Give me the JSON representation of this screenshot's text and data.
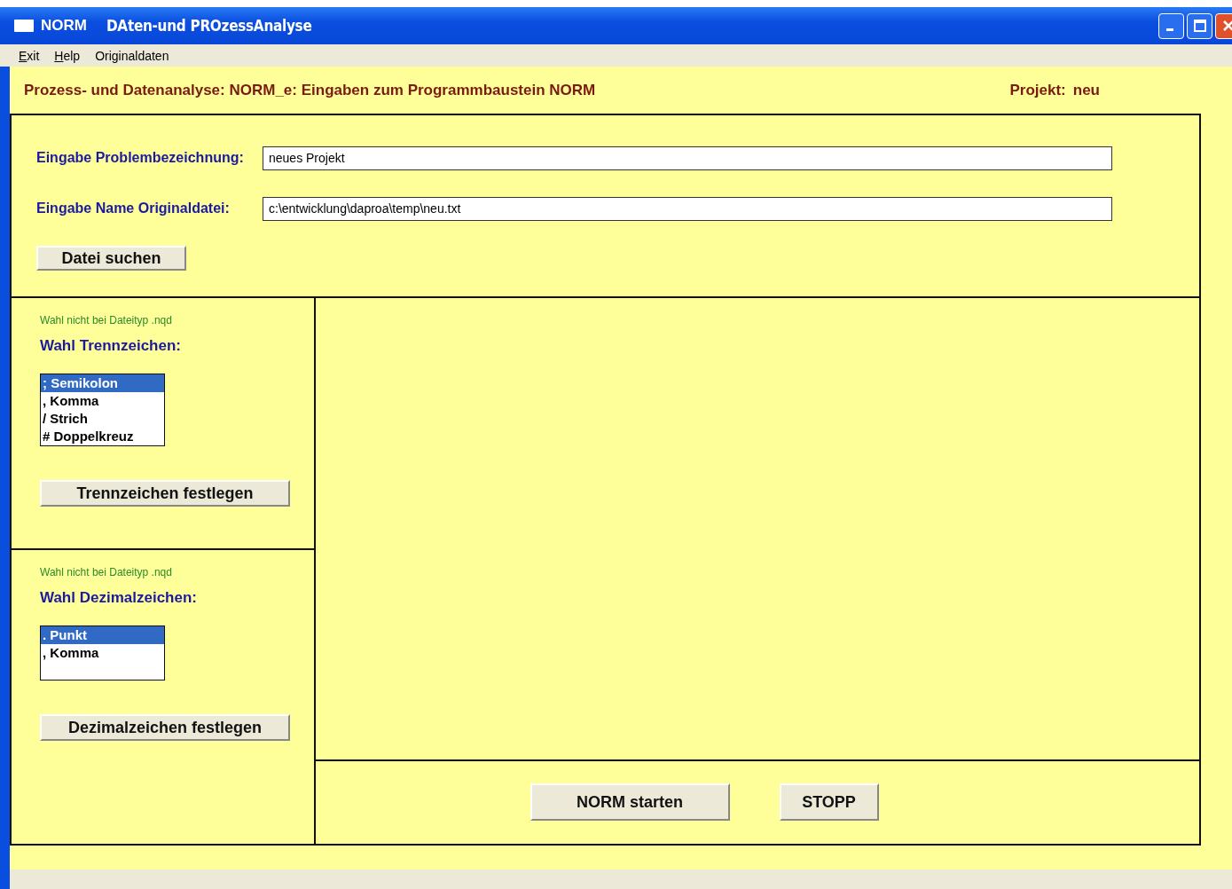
{
  "window": {
    "app": "NORM",
    "title": "DAten-und PROzessAnalyse"
  },
  "menu": [
    {
      "label": "Exit",
      "mnemonic": true
    },
    {
      "label": "Help",
      "mnemonic": true
    },
    {
      "label": "Originaldaten",
      "mnemonic": false
    }
  ],
  "header": {
    "title": "Prozess- und Datenanalyse: NORM_e: Eingaben zum Programmbaustein NORM",
    "project_label": "Projekt:",
    "project": "neu"
  },
  "fields": [
    {
      "label": "Eingabe Problembezeichnung:",
      "value": "neues Projekt"
    },
    {
      "label": "Eingabe Name Originaldatei:",
      "value": "c:\\entwicklung\\daproa\\temp\\neu.txt"
    }
  ],
  "file_button": "Datei suchen",
  "separator_panel": {
    "note": "Wahl nicht bei Dateityp .nqd",
    "title": "Wahl Trennzeichen:",
    "options": [
      {
        "label": "; Semikolon",
        "selected": true
      },
      {
        "label": ", Komma",
        "selected": false
      },
      {
        "label": "/ Strich",
        "selected": false
      },
      {
        "label": "# Doppelkreuz",
        "selected": false
      }
    ],
    "button": "Trennzeichen festlegen"
  },
  "decimal_panel": {
    "note": "Wahl nicht bei Dateityp .nqd",
    "title": "Wahl Dezimalzeichen:",
    "options": [
      {
        "label": ". Punkt",
        "selected": true
      },
      {
        "label": ", Komma",
        "selected": false
      }
    ],
    "button": "Dezimalzeichen festlegen"
  },
  "actions": [
    "NORM starten",
    "STOPP"
  ]
}
